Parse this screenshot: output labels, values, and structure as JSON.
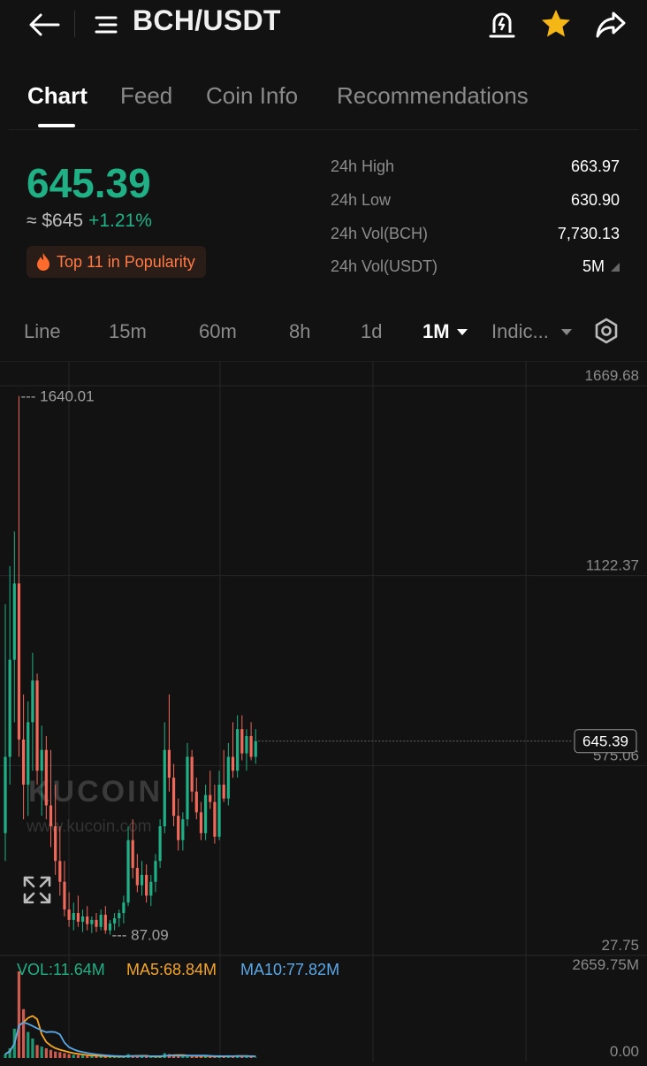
{
  "header": {
    "title": "BCH/USDT",
    "back_icon": "arrow-left-icon",
    "menu_icon": "menu-icon",
    "alert_icon": "price-alert-icon",
    "favorite_icon": "star-icon",
    "share_icon": "share-icon",
    "favorite_color": "#F5B716"
  },
  "tabs": [
    {
      "label": "Chart",
      "active": true
    },
    {
      "label": "Feed",
      "active": false
    },
    {
      "label": "Coin Info",
      "active": false
    },
    {
      "label": "Recommendations",
      "active": false
    }
  ],
  "price": {
    "last": "645.39",
    "fiat": "≈ $645",
    "change": "+1.21%",
    "popularity": "Top 11 in Popularity",
    "up_color": "#1FB185",
    "down_color": "#F0695A"
  },
  "stats": [
    {
      "label": "24h High",
      "value": "663.97"
    },
    {
      "label": "24h Low",
      "value": "630.90"
    },
    {
      "label": "24h Vol(BCH)",
      "value": "7,730.13"
    },
    {
      "label": "24h Vol(USDT)",
      "value": "5M"
    }
  ],
  "timeframes": [
    {
      "label": "Line",
      "active": false
    },
    {
      "label": "15m",
      "active": false
    },
    {
      "label": "60m",
      "active": false
    },
    {
      "label": "8h",
      "active": false
    },
    {
      "label": "1d",
      "active": false
    },
    {
      "label": "1M",
      "active": true
    },
    {
      "label": "Indic...",
      "active": false
    }
  ],
  "settings_icon": "hexagon-settings-icon",
  "chart_data": {
    "type": "candlestick",
    "price_axis_labels": [
      "1669.68",
      "1122.37",
      "575.06",
      "27.75"
    ],
    "last_price_label": "645.39",
    "high_marker": "1640.01",
    "low_marker": "87.09",
    "watermark": "KUCOIN",
    "watermark_url": "www.kucoin.com",
    "candles": [
      {
        "o": 380,
        "h": 1040,
        "l": 300,
        "c": 600
      },
      {
        "o": 600,
        "h": 1150,
        "l": 520,
        "c": 880
      },
      {
        "o": 880,
        "h": 1250,
        "l": 700,
        "c": 1100
      },
      {
        "o": 1100,
        "h": 1640.01,
        "l": 600,
        "c": 650
      },
      {
        "o": 650,
        "h": 780,
        "l": 420,
        "c": 520
      },
      {
        "o": 520,
        "h": 760,
        "l": 430,
        "c": 700
      },
      {
        "o": 700,
        "h": 900,
        "l": 560,
        "c": 820
      },
      {
        "o": 820,
        "h": 840,
        "l": 520,
        "c": 560
      },
      {
        "o": 560,
        "h": 690,
        "l": 430,
        "c": 620
      },
      {
        "o": 620,
        "h": 660,
        "l": 420,
        "c": 460
      },
      {
        "o": 460,
        "h": 620,
        "l": 340,
        "c": 400
      },
      {
        "o": 400,
        "h": 520,
        "l": 260,
        "c": 300
      },
      {
        "o": 300,
        "h": 400,
        "l": 200,
        "c": 240
      },
      {
        "o": 240,
        "h": 300,
        "l": 140,
        "c": 160
      },
      {
        "o": 160,
        "h": 210,
        "l": 110,
        "c": 130
      },
      {
        "o": 130,
        "h": 180,
        "l": 100,
        "c": 150
      },
      {
        "o": 150,
        "h": 200,
        "l": 110,
        "c": 125
      },
      {
        "o": 125,
        "h": 160,
        "l": 95,
        "c": 140
      },
      {
        "o": 140,
        "h": 170,
        "l": 100,
        "c": 118
      },
      {
        "o": 118,
        "h": 140,
        "l": 92,
        "c": 130
      },
      {
        "o": 130,
        "h": 150,
        "l": 95,
        "c": 110
      },
      {
        "o": 110,
        "h": 160,
        "l": 100,
        "c": 145
      },
      {
        "o": 145,
        "h": 170,
        "l": 90,
        "c": 100
      },
      {
        "o": 100,
        "h": 130,
        "l": 87.09,
        "c": 120
      },
      {
        "o": 120,
        "h": 150,
        "l": 100,
        "c": 135
      },
      {
        "o": 135,
        "h": 160,
        "l": 110,
        "c": 150
      },
      {
        "o": 150,
        "h": 200,
        "l": 120,
        "c": 180
      },
      {
        "o": 180,
        "h": 400,
        "l": 170,
        "c": 360
      },
      {
        "o": 360,
        "h": 420,
        "l": 250,
        "c": 280
      },
      {
        "o": 280,
        "h": 320,
        "l": 210,
        "c": 230
      },
      {
        "o": 230,
        "h": 300,
        "l": 200,
        "c": 260
      },
      {
        "o": 260,
        "h": 290,
        "l": 180,
        "c": 200
      },
      {
        "o": 200,
        "h": 260,
        "l": 170,
        "c": 240
      },
      {
        "o": 240,
        "h": 320,
        "l": 210,
        "c": 300
      },
      {
        "o": 300,
        "h": 420,
        "l": 280,
        "c": 400
      },
      {
        "o": 400,
        "h": 700,
        "l": 380,
        "c": 620
      },
      {
        "o": 620,
        "h": 780,
        "l": 500,
        "c": 540
      },
      {
        "o": 540,
        "h": 580,
        "l": 400,
        "c": 430
      },
      {
        "o": 430,
        "h": 480,
        "l": 330,
        "c": 360
      },
      {
        "o": 360,
        "h": 440,
        "l": 330,
        "c": 420
      },
      {
        "o": 420,
        "h": 640,
        "l": 400,
        "c": 600
      },
      {
        "o": 600,
        "h": 620,
        "l": 470,
        "c": 500
      },
      {
        "o": 500,
        "h": 540,
        "l": 420,
        "c": 440
      },
      {
        "o": 440,
        "h": 470,
        "l": 360,
        "c": 380
      },
      {
        "o": 380,
        "h": 520,
        "l": 360,
        "c": 490
      },
      {
        "o": 490,
        "h": 560,
        "l": 450,
        "c": 470
      },
      {
        "o": 470,
        "h": 520,
        "l": 350,
        "c": 370
      },
      {
        "o": 370,
        "h": 560,
        "l": 360,
        "c": 520
      },
      {
        "o": 520,
        "h": 620,
        "l": 470,
        "c": 480
      },
      {
        "o": 480,
        "h": 640,
        "l": 460,
        "c": 600
      },
      {
        "o": 600,
        "h": 700,
        "l": 540,
        "c": 560
      },
      {
        "o": 560,
        "h": 720,
        "l": 540,
        "c": 680
      },
      {
        "o": 680,
        "h": 720,
        "l": 590,
        "c": 610
      },
      {
        "o": 610,
        "h": 680,
        "l": 560,
        "c": 660
      },
      {
        "o": 660,
        "h": 700,
        "l": 590,
        "c": 600
      },
      {
        "o": 600,
        "h": 680,
        "l": 580,
        "c": 645.39
      }
    ],
    "volume": {
      "legend": {
        "vol": "VOL:11.64M",
        "ma5": "MA5:68.84M",
        "ma10": "MA10:77.82M"
      },
      "axis_labels": [
        "2659.75M",
        "0.00"
      ],
      "values": [
        120,
        300,
        900,
        2659,
        1500,
        800,
        600,
        400,
        350,
        300,
        250,
        200,
        180,
        150,
        120,
        100,
        90,
        80,
        70,
        60,
        60,
        55,
        50,
        45,
        45,
        40,
        40,
        120,
        80,
        60,
        50,
        45,
        40,
        40,
        50,
        150,
        120,
        80,
        60,
        50,
        90,
        70,
        60,
        50,
        60,
        50,
        40,
        60,
        50,
        70,
        60,
        80,
        60,
        50,
        40,
        12
      ],
      "ma5_color": "#F5A623",
      "ma10_color": "#5AA8E8",
      "vol_color": "#1FB185"
    }
  }
}
